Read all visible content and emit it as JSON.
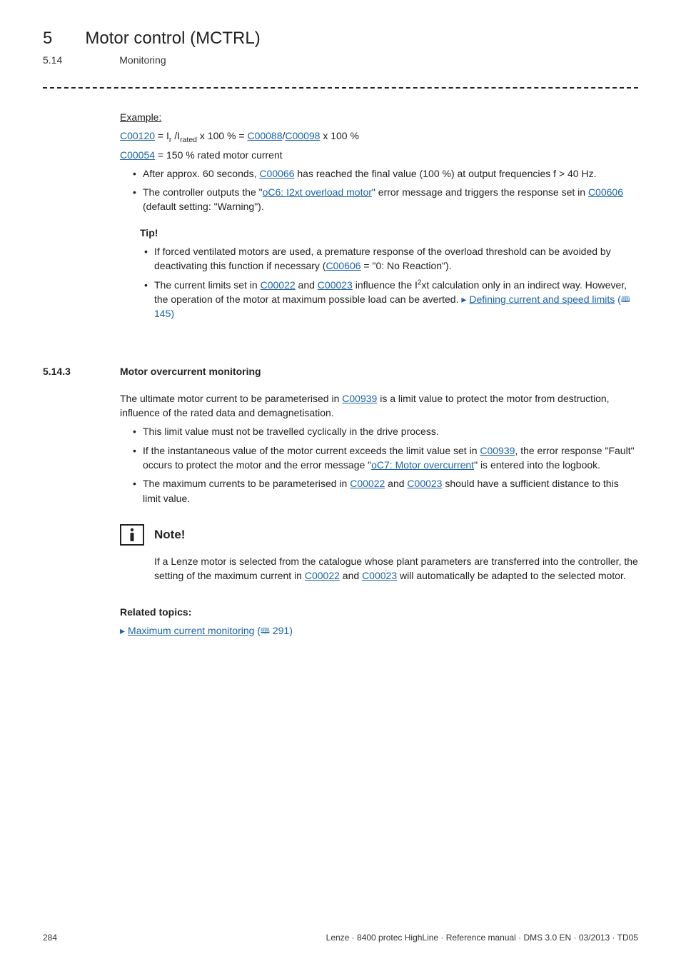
{
  "header": {
    "chapter_num": "5",
    "chapter_title": "Motor control (MCTRL)",
    "section_num": "5.14",
    "section_title": "Monitoring"
  },
  "example": {
    "label": "Example:",
    "formula_pre": " = I",
    "formula_sub1": "r",
    "formula_mid1": " /I",
    "formula_sub2": "rated",
    "formula_mid2": " x 100 % = ",
    "formula_slash": "/",
    "formula_post": " x 100 %",
    "c00120": "C00120",
    "c00088": "C00088",
    "c00098": "C00098",
    "c00054_line_pre": " = 150 % rated motor current",
    "c00054": "C00054",
    "bullet1_pre": "After approx. 60 seconds, ",
    "c00066": "C00066",
    "bullet1_post": " has reached the final value (100 %) at output frequencies f > 40 Hz.",
    "bullet2_pre": "The controller outputs the \"",
    "err1": "oC6: I2xt overload motor",
    "bullet2_mid": "\" error message and triggers the response set in ",
    "c00606": "C00606",
    "bullet2_post": " (default setting: \"Warning\")."
  },
  "tip": {
    "label": "Tip!",
    "item1_pre": "If forced ventilated motors are used, a premature response of the overload threshold can be avoided by deactivating this function if necessary (",
    "item1_link": "C00606",
    "item1_post": " = \"0: No Reaction\").",
    "item2_pre": "The current limits set in ",
    "c00022": "C00022",
    "and": " and ",
    "c00023": "C00023",
    "item2_mid": " influence the I",
    "item2_mid2": "xt calculation only in an indirect way. However, the operation of the motor at maximum possible load can be averted.  ",
    "item2_link": "Defining current and speed limits",
    "item2_ref": " 145)"
  },
  "subsection": {
    "num": "5.14.3",
    "title": "Motor overcurrent monitoring",
    "intro_pre": "The ultimate motor current to be parameterised in ",
    "c00939": "C00939",
    "intro_post": " is a limit value to protect the motor from destruction, influence of the rated data and demagnetisation.",
    "b1": "This limit value must not be travelled cyclically in the drive process.",
    "b2_pre": "If the instantaneous value of the motor current exceeds the limit value set in ",
    "b2_mid": ", the error response \"Fault\" occurs to protect the motor and the error message \"",
    "err2": "oC7: Motor overcurrent",
    "b2_post": "\" is entered into the logbook.",
    "b3_pre": "The maximum currents to be parameterised in ",
    "b3_post": " should have a sufficient distance to this limit value."
  },
  "note": {
    "label": "Note!",
    "body_pre": "If a Lenze motor is selected from the catalogue whose plant parameters are transferred into the controller, the setting of the maximum current in ",
    "body_post": " will automatically be adapted to the selected motor."
  },
  "related": {
    "title": "Related topics:",
    "item": "Maximum current monitoring",
    "ref": " 291)"
  },
  "footer": {
    "page": "284",
    "meta": "Lenze · 8400 protec HighLine · Reference manual · DMS 3.0 EN · 03/2013 · TD05"
  }
}
